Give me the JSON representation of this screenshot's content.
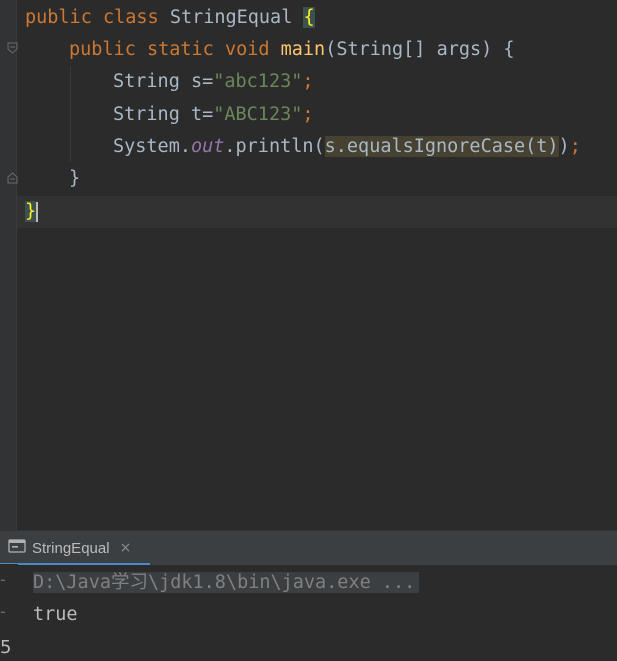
{
  "editor": {
    "lines": [
      {
        "parts": [
          "public",
          "class",
          "StringEqual",
          "{"
        ]
      },
      {
        "parts": [
          "public",
          "static",
          "void",
          "main",
          "(String[] args) {"
        ]
      },
      {
        "parts": [
          "String s=",
          "\"abc123\"",
          ";"
        ]
      },
      {
        "parts": [
          "String t=",
          "\"ABC123\"",
          ";"
        ]
      },
      {
        "parts": [
          "System.",
          "out",
          ".println(",
          "s.equalsIgnoreCase(t)",
          ")",
          ";"
        ]
      },
      {
        "parts": [
          "}"
        ]
      },
      {
        "parts": [
          "}"
        ]
      }
    ]
  },
  "run_panel": {
    "tab_label": "StringEqual",
    "close_glyph": "×",
    "command": "D:\\Java学习\\jdk1.8\\bin\\java.exe ...",
    "output": "true",
    "gutter_mark": "5"
  },
  "colors": {
    "background": "#2b2b2b",
    "keyword": "#cc7832",
    "string": "#6a8759",
    "method": "#ffc66d",
    "field": "#9876aa",
    "text": "#a9b7c6"
  }
}
